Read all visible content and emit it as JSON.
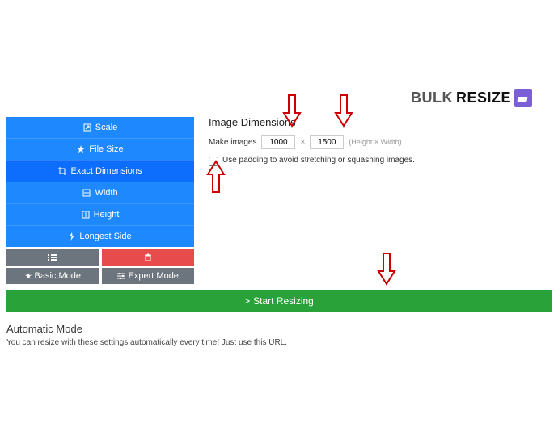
{
  "logo": {
    "bulk": "BULK",
    "re": "RE",
    "size": "SIZE"
  },
  "sidebar": {
    "items": [
      {
        "label": "Scale",
        "icon": "resize"
      },
      {
        "label": "File Size",
        "icon": "star"
      },
      {
        "label": "Exact Dimensions",
        "icon": "crop",
        "active": true
      },
      {
        "label": "Width",
        "icon": "width"
      },
      {
        "label": "Height",
        "icon": "height"
      },
      {
        "label": "Longest Side",
        "icon": "bolt"
      }
    ]
  },
  "toolbar": {
    "list_icon": "list",
    "trash_icon": "trash",
    "basic_label": "Basic Mode",
    "expert_label": "Expert Mode"
  },
  "dimensions": {
    "title": "Image Dimensions",
    "make_images": "Make images",
    "height_val": "1000",
    "mult": "×",
    "width_val": "1500",
    "hint": "(Height  ×  Width)",
    "padding_label": "Use padding to avoid stretching or squashing images."
  },
  "start": {
    "chevron": ">",
    "label": "Start Resizing"
  },
  "auto": {
    "title": "Automatic Mode",
    "text": "You can resize with these settings automatically every time! Just use this URL."
  }
}
